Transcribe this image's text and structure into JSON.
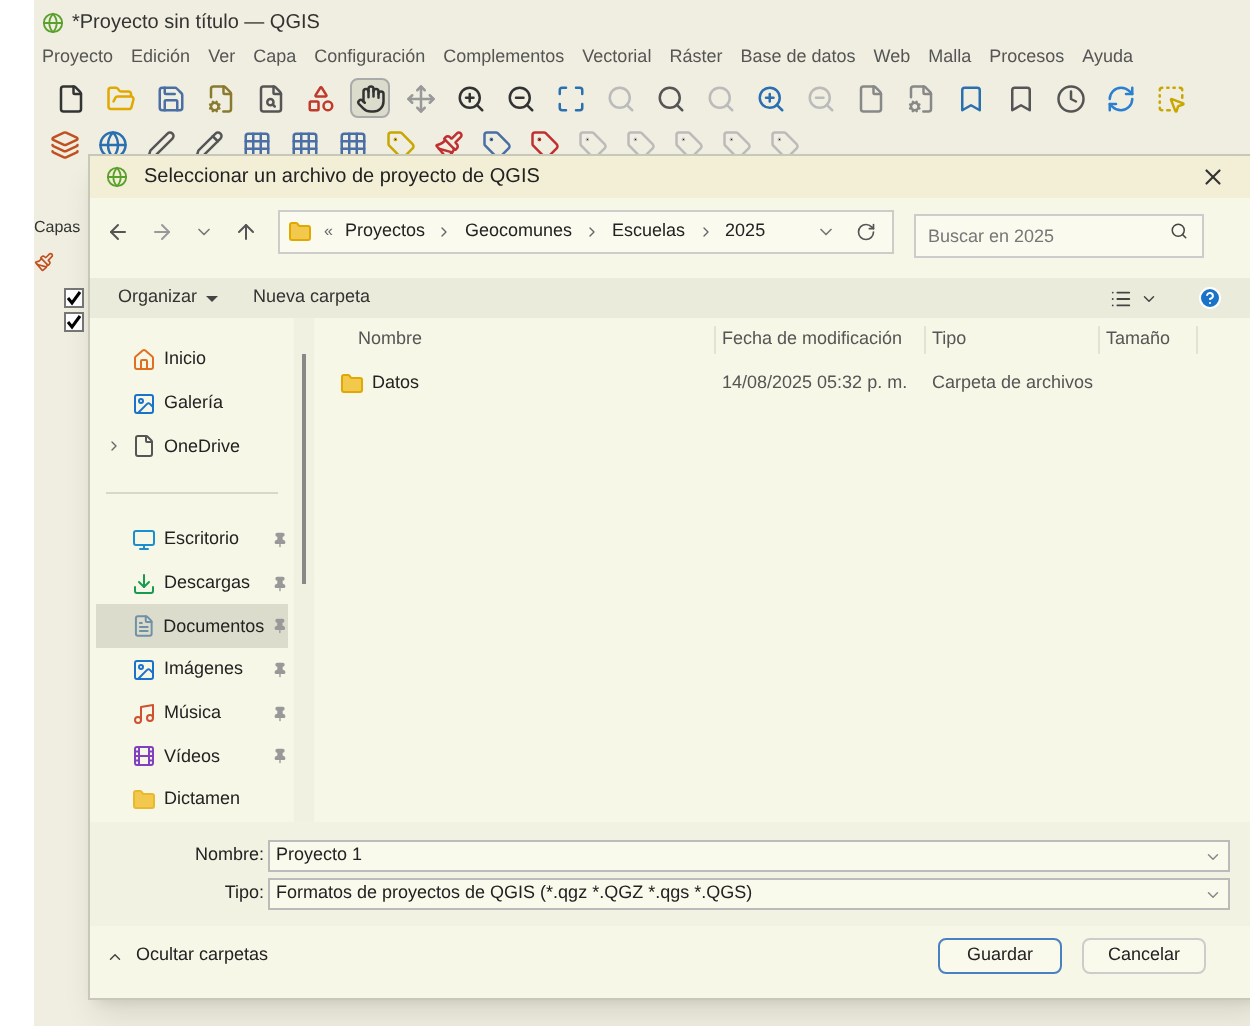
{
  "window": {
    "title": "*Proyecto sin título — QGIS"
  },
  "menu": [
    "Proyecto",
    "Edición",
    "Ver",
    "Capa",
    "Configuración",
    "Complementos",
    "Vectorial",
    "Ráster",
    "Base de datos",
    "Web",
    "Malla",
    "Procesos",
    "Ayuda"
  ],
  "layers_panel": {
    "title": "Capas",
    "layers": [
      {
        "checked": true
      },
      {
        "checked": true
      }
    ]
  },
  "dialog": {
    "title": "Seleccionar un archivo de proyecto de QGIS",
    "breadcrumb_prefix": "«",
    "breadcrumb": [
      "Proyectos",
      "Geocomunes",
      "Escuelas",
      "2025"
    ],
    "search": {
      "placeholder": "Buscar en 2025"
    },
    "commands": {
      "organize": "Organizar",
      "new_folder": "Nueva carpeta"
    },
    "nav": [
      {
        "kind": "home",
        "label": "Inicio",
        "pinned": false,
        "selected": false
      },
      {
        "kind": "gallery",
        "label": "Galería",
        "pinned": false,
        "selected": false
      },
      {
        "kind": "cloud",
        "label": "OneDrive",
        "pinned": false,
        "selected": false,
        "expandable": true
      },
      {
        "kind": "divider"
      },
      {
        "kind": "desktop",
        "label": "Escritorio",
        "pinned": true,
        "selected": false
      },
      {
        "kind": "downloads",
        "label": "Descargas",
        "pinned": true,
        "selected": false
      },
      {
        "kind": "documents",
        "label": "Documentos",
        "pinned": true,
        "selected": true
      },
      {
        "kind": "images",
        "label": "Imágenes",
        "pinned": true,
        "selected": false
      },
      {
        "kind": "music",
        "label": "Música",
        "pinned": true,
        "selected": false
      },
      {
        "kind": "videos",
        "label": "Vídeos",
        "pinned": true,
        "selected": false
      },
      {
        "kind": "folder",
        "label": "Dictamen",
        "pinned": false,
        "selected": false
      }
    ],
    "columns": [
      "Nombre",
      "Fecha de modificación",
      "Tipo",
      "Tamaño"
    ],
    "rows": [
      {
        "name": "Datos",
        "modified": "14/08/2025 05:32 p. m.",
        "type": "Carpeta de archivos"
      }
    ],
    "file_name": {
      "label": "Nombre:",
      "value": "Proyecto 1"
    },
    "file_type": {
      "label": "Tipo:",
      "value": "Formatos de proyectos de QGIS (*.qgz *.QGZ *.qgs *.QGS)"
    },
    "hide_folders": "Ocultar carpetas",
    "buttons": [
      {
        "label": "Guardar",
        "default": true
      },
      {
        "label": "Cancelar",
        "default": false
      }
    ]
  }
}
